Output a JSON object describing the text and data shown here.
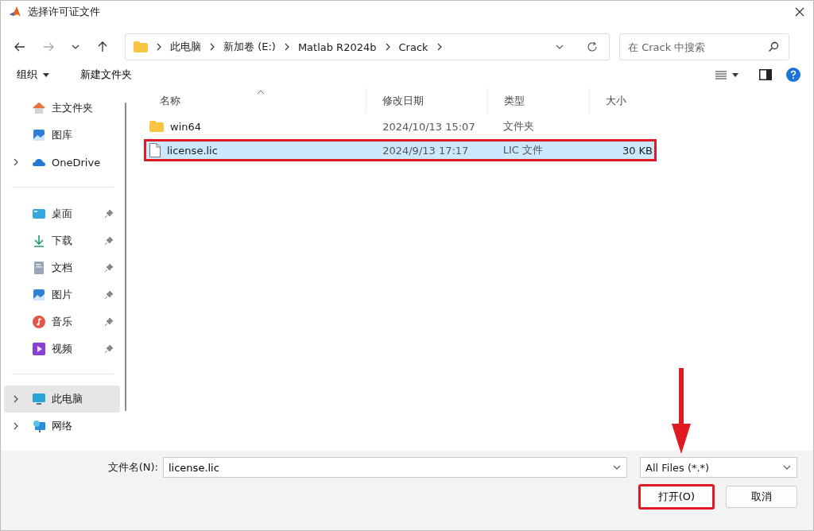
{
  "window": {
    "title": "选择许可证文件"
  },
  "address": {
    "crumbs": [
      "此电脑",
      "新加卷 (E:)",
      "Matlab R2024b",
      "Crack"
    ]
  },
  "search": {
    "placeholder": "在 Crack 中搜索"
  },
  "toolbar": {
    "organize": "组织",
    "new_folder": "新建文件夹"
  },
  "sidebar": {
    "groups": [
      [
        {
          "label": "主文件夹",
          "kind": "home",
          "expandable": false,
          "pinned": false,
          "selected": false
        },
        {
          "label": "图库",
          "kind": "gallery",
          "expandable": false,
          "pinned": false,
          "selected": false
        },
        {
          "label": "OneDrive",
          "kind": "cloud",
          "expandable": true,
          "pinned": false,
          "selected": false
        }
      ],
      [
        {
          "label": "桌面",
          "kind": "desktop",
          "expandable": false,
          "pinned": true,
          "selected": false
        },
        {
          "label": "下载",
          "kind": "download",
          "expandable": false,
          "pinned": true,
          "selected": false
        },
        {
          "label": "文档",
          "kind": "document",
          "expandable": false,
          "pinned": true,
          "selected": false
        },
        {
          "label": "图片",
          "kind": "gallery",
          "expandable": false,
          "pinned": true,
          "selected": false
        },
        {
          "label": "音乐",
          "kind": "music",
          "expandable": false,
          "pinned": true,
          "selected": false
        },
        {
          "label": "视频",
          "kind": "video",
          "expandable": false,
          "pinned": true,
          "selected": false
        }
      ],
      [
        {
          "label": "此电脑",
          "kind": "pc",
          "expandable": true,
          "pinned": false,
          "selected": true
        },
        {
          "label": "网络",
          "kind": "network",
          "expandable": true,
          "pinned": false,
          "selected": false
        }
      ]
    ]
  },
  "table": {
    "columns": [
      "名称",
      "修改日期",
      "类型",
      "大小"
    ],
    "rows": [
      {
        "kind": "folder",
        "name": "win64",
        "date": "2024/10/13 15:07",
        "type": "文件夹",
        "size": "",
        "selected": false,
        "highlighted": false
      },
      {
        "kind": "file",
        "name": "license.lic",
        "date": "2024/9/13 17:17",
        "type": "LIC 文件",
        "size": "30 KB",
        "selected": true,
        "highlighted": true
      }
    ]
  },
  "filename": {
    "label": "文件名(N):",
    "value": "license.lic"
  },
  "filter": {
    "value": "All Files (*.*)"
  },
  "buttons": [
    {
      "label": "打开(O)",
      "highlighted": true
    },
    {
      "label": "取消",
      "highlighted": false
    }
  ]
}
